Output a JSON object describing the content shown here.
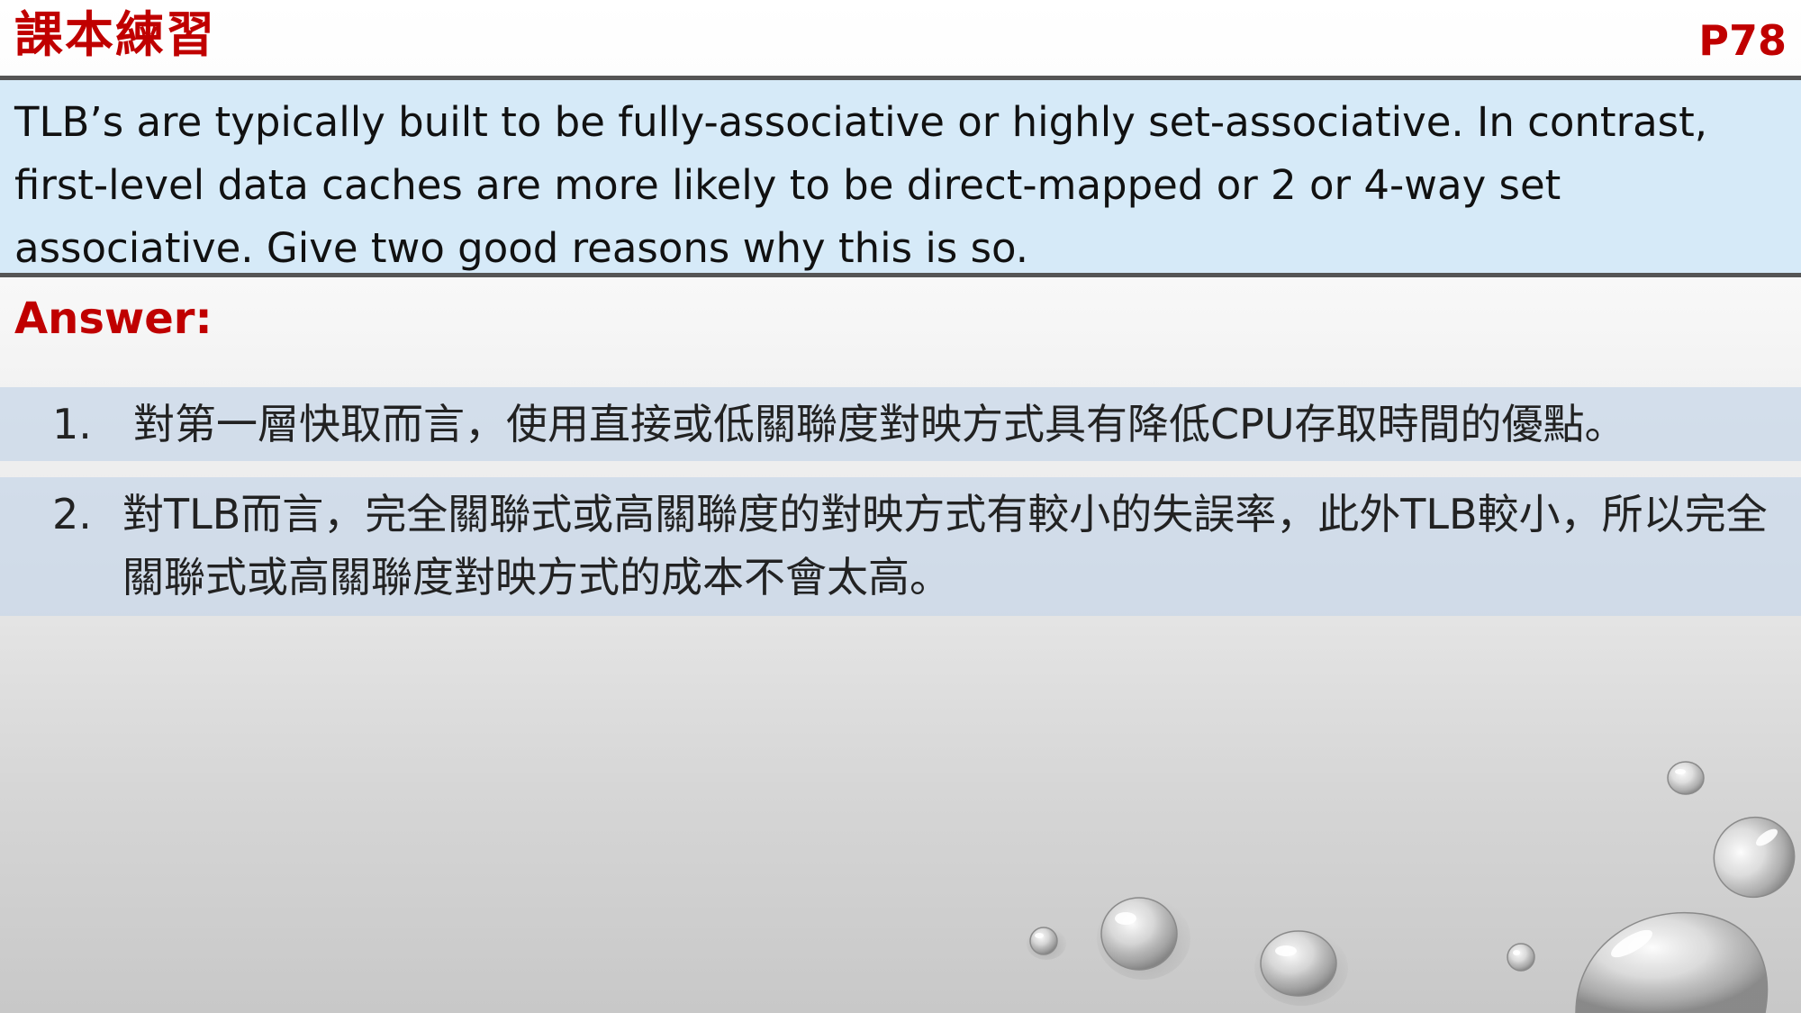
{
  "header": {
    "title": "課本練習",
    "page": "P78"
  },
  "question": {
    "text": "TLB’s are typically built to be fully-associative or highly set-associative. In contrast, first-level data caches are more likely to be direct-mapped or 2 or 4-way set associative. Give two good reasons why this is so."
  },
  "answer": {
    "label": "Answer:",
    "items": [
      {
        "number": "1.",
        "text": "對第一層快取而言，使用直接或低關聯度對映方式具有降低CPU存取時間的優點。"
      },
      {
        "number": "2.",
        "text": "對TLB而言，完全關聯式或高關聯度的對映方式有較小的失誤率，此外TLB較小，所以完全關聯式或高關聯度對映方式的成本不會太高。"
      }
    ]
  },
  "colors": {
    "accent": "#c00000",
    "question_bg": "#d6eaf8",
    "answer_bg": "#c8d7e8",
    "rule": "#555555"
  }
}
